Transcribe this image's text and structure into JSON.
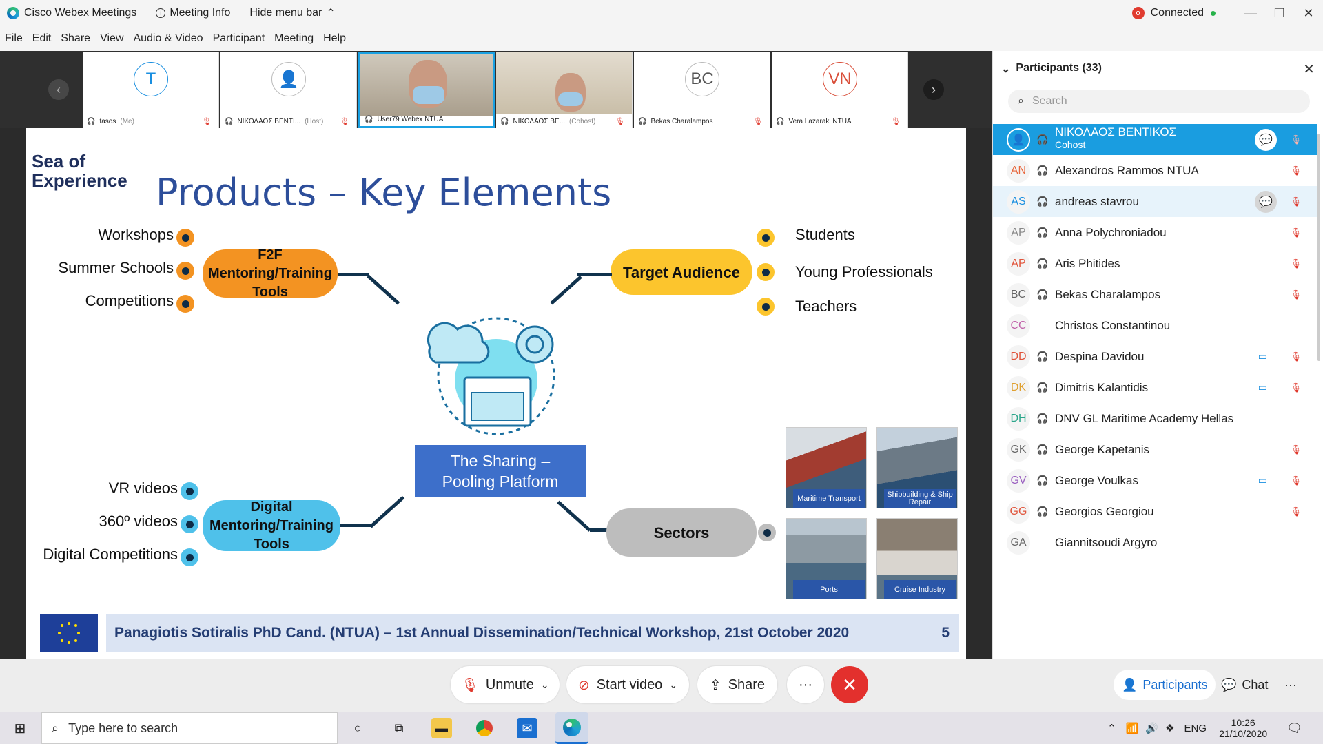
{
  "titlebar": {
    "app_name": "Cisco Webex Meetings",
    "meeting_info": "Meeting Info",
    "hide_menu": "Hide menu bar",
    "status": "Connected",
    "status_badge": "o"
  },
  "menu": [
    "File",
    "Edit",
    "Share",
    "View",
    "Audio & Video",
    "Participant",
    "Meeting",
    "Help"
  ],
  "strip": [
    {
      "initials": "T",
      "name": "tasos",
      "role": "(Me)",
      "video": false,
      "ini_color": "#1a8fe0"
    },
    {
      "initials": "",
      "name": "ΝΙΚΟΛΑΟΣ ΒΕΝΤΙ...",
      "role": "(Host)",
      "video": false,
      "ini_color": "#aaa"
    },
    {
      "initials": "",
      "name": "User79 Webex NTUA",
      "role": "",
      "video": true,
      "active": true
    },
    {
      "initials": "",
      "name": "ΝΙΚΟΛΑΟΣ ΒΕ...",
      "role": "(Cohost)",
      "video": true
    },
    {
      "initials": "BC",
      "name": "Bekas Charalampos",
      "role": "",
      "video": false,
      "ini_color": "#555"
    },
    {
      "initials": "VN",
      "name": "Vera Lazaraki NTUA",
      "role": "",
      "video": false,
      "ini_color": "#d94f3a"
    }
  ],
  "slide": {
    "brand_line1": "Sea of",
    "brand_line2": "Experience",
    "title": "Products – Key Elements",
    "f2f_node": "F2F Mentoring/Training Tools",
    "f2f_items": [
      "Workshops",
      "Summer Schools",
      "Competitions"
    ],
    "digital_node": "Digital Mentoring/Training Tools",
    "digital_items": [
      "VR videos",
      "360º videos",
      "Digital Competitions"
    ],
    "audience_node": "Target Audience",
    "audience_items": [
      "Students",
      "Young Professionals",
      "Teachers"
    ],
    "sectors_node": "Sectors",
    "platform_line1": "The Sharing –",
    "platform_line2": "Pooling Platform",
    "photos": [
      "Maritime Transport",
      "Shipbuilding & Ship Repair",
      "Ports",
      "Cruise Industry"
    ],
    "footer": "Panagiotis Sotiralis PhD Cand. (NTUA) – 1st Annual Dissemination/Technical Workshop, 21st October 2020",
    "page": "5"
  },
  "toolbar": {
    "unmute": "Unmute",
    "start_video": "Start video",
    "share": "Share",
    "more": "···"
  },
  "panel": {
    "title": "Participants (33)",
    "search_placeholder": "Search",
    "participants": [
      {
        "initials": "",
        "name": "ΝΙΚΟΛΑΟΣ ΒΕΝΤΙΚΟΣ",
        "sub": "Cohost",
        "selected": true,
        "chat": true,
        "color": "#fff"
      },
      {
        "initials": "AN",
        "name": "Alexandros Rammos NTUA",
        "color": "#e8673c"
      },
      {
        "initials": "AS",
        "name": "andreas stavrou",
        "hover": true,
        "chat": true,
        "color": "#1a8fe0"
      },
      {
        "initials": "AP",
        "name": "Anna Polychroniadou",
        "color": "#888"
      },
      {
        "initials": "AP",
        "name": "Aris Phitides",
        "color": "#e0533a"
      },
      {
        "initials": "BC",
        "name": "Bekas Charalampos",
        "color": "#666"
      },
      {
        "initials": "CC",
        "name": "Christos Constantinou",
        "nohs": true,
        "nomic": true,
        "color": "#c05fa8"
      },
      {
        "initials": "DD",
        "name": "Despina Davidou",
        "cam": true,
        "color": "#e0533a"
      },
      {
        "initials": "DK",
        "name": "Dimitris Kalantidis",
        "cam": true,
        "color": "#e0a030"
      },
      {
        "initials": "DH",
        "name": "DNV GL Maritime Academy Hellas",
        "nomic": true,
        "color": "#2aa58a"
      },
      {
        "initials": "GK",
        "name": "George Kapetanis",
        "color": "#666"
      },
      {
        "initials": "GV",
        "name": "George Voulkas",
        "cam": true,
        "color": "#9a5fc0"
      },
      {
        "initials": "GG",
        "name": "Georgios Georgiou",
        "color": "#e0533a"
      },
      {
        "initials": "GA",
        "name": "Giannitsoudi Argyro",
        "nohs": true,
        "nomic": true,
        "color": "#666"
      }
    ],
    "participants_btn": "Participants",
    "chat_btn": "Chat",
    "more": "···"
  },
  "taskbar": {
    "search_placeholder": "Type here to search",
    "lang": "ENG",
    "time": "10:26",
    "date": "21/10/2020"
  },
  "colors": {
    "accent": "#1aa1e3",
    "f2f": "#f39322",
    "digital": "#4fc1ea",
    "audience": "#fcc52d",
    "sectors": "#bdbdbd",
    "end": "#e3302d"
  }
}
